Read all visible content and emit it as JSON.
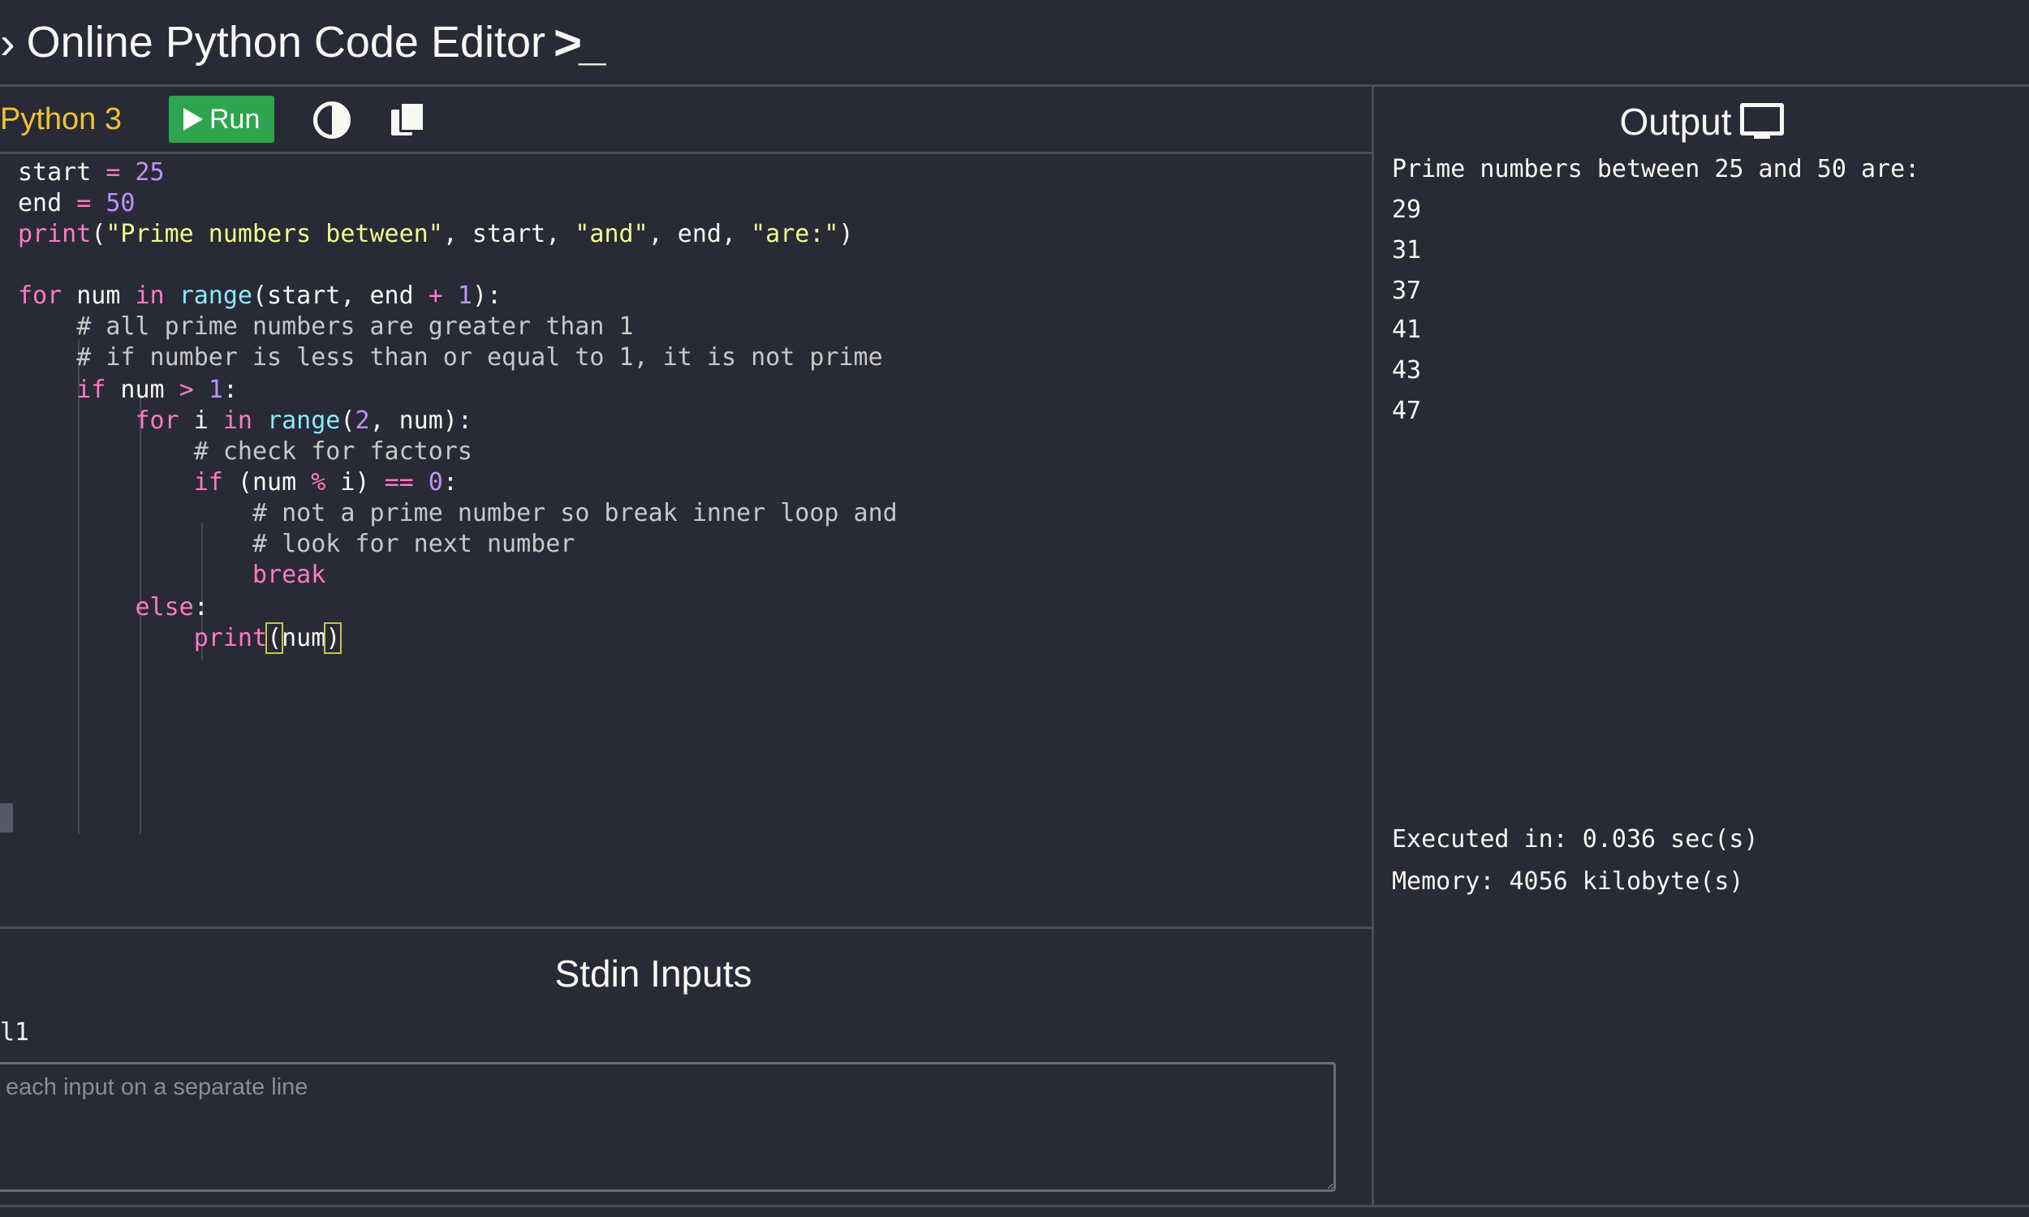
{
  "header": {
    "chevron": "›",
    "title": "Online Python Code Editor",
    "terminal": ">_"
  },
  "toolbar": {
    "language": "Python 3",
    "run_label": "Run",
    "icons": [
      "contrast-icon",
      "copy-icon"
    ]
  },
  "code_lines": [
    [
      [
        "start ",
        "t"
      ],
      [
        "=",
        "op"
      ],
      [
        " ",
        "t"
      ],
      [
        "25",
        "num"
      ]
    ],
    [
      [
        "end ",
        "t"
      ],
      [
        "=",
        "op"
      ],
      [
        " ",
        "t"
      ],
      [
        "50",
        "num"
      ]
    ],
    [
      [
        "print",
        "fn"
      ],
      [
        "(",
        "t"
      ],
      [
        "\"Prime numbers between\"",
        "str"
      ],
      [
        ", start, ",
        "t"
      ],
      [
        "\"and\"",
        "str"
      ],
      [
        ", end, ",
        "t"
      ],
      [
        "\"are:\"",
        "str"
      ],
      [
        ")",
        "t"
      ]
    ],
    [],
    [
      [
        "for",
        "kw"
      ],
      [
        " num ",
        "t"
      ],
      [
        "in",
        "kw"
      ],
      [
        " ",
        "t"
      ],
      [
        "range",
        "bi"
      ],
      [
        "(start, end ",
        "t"
      ],
      [
        "+",
        "op"
      ],
      [
        " ",
        "t"
      ],
      [
        "1",
        "num"
      ],
      [
        "):",
        "t"
      ]
    ],
    [
      [
        "    # all prime numbers are greater than 1",
        "cm"
      ]
    ],
    [
      [
        "    # if number is less than or equal to 1, it is not prime",
        "cm"
      ]
    ],
    [
      [
        "    ",
        "t"
      ],
      [
        "if",
        "kw"
      ],
      [
        " num ",
        "t"
      ],
      [
        ">",
        "op"
      ],
      [
        " ",
        "t"
      ],
      [
        "1",
        "num"
      ],
      [
        ":",
        "t"
      ]
    ],
    [
      [
        "        ",
        "t"
      ],
      [
        "for",
        "kw"
      ],
      [
        " i ",
        "t"
      ],
      [
        "in",
        "kw"
      ],
      [
        " ",
        "t"
      ],
      [
        "range",
        "bi"
      ],
      [
        "(",
        "t"
      ],
      [
        "2",
        "num"
      ],
      [
        ", num):",
        "t"
      ]
    ],
    [
      [
        "            # check for factors",
        "cm"
      ]
    ],
    [
      [
        "            ",
        "t"
      ],
      [
        "if",
        "kw"
      ],
      [
        " (num ",
        "t"
      ],
      [
        "%",
        "op"
      ],
      [
        " i) ",
        "t"
      ],
      [
        "==",
        "op"
      ],
      [
        " ",
        "t"
      ],
      [
        "0",
        "num"
      ],
      [
        ":",
        "t"
      ]
    ],
    [
      [
        "                # not a prime number so break inner loop and",
        "cm"
      ]
    ],
    [
      [
        "                # look for next number",
        "cm"
      ]
    ],
    [
      [
        "                ",
        "t"
      ],
      [
        "break",
        "kw"
      ]
    ],
    [
      [
        "        ",
        "t"
      ],
      [
        "else",
        "kw"
      ],
      [
        ":",
        "t"
      ]
    ],
    [
      [
        "            ",
        "t"
      ],
      [
        "print",
        "fn"
      ],
      [
        "(",
        "match"
      ],
      [
        "num",
        "t"
      ],
      [
        ")",
        "match"
      ]
    ]
  ],
  "stdin": {
    "title": "Stdin Inputs",
    "value_label": "l1",
    "placeholder": "each input on a separate line"
  },
  "output": {
    "title": "Output",
    "lines": [
      "Prime numbers between 25 and 50 are:",
      "29",
      "31",
      "37",
      "41",
      "43",
      "47"
    ],
    "executed": "Executed in: 0.036 sec(s)",
    "memory": "Memory: 4056 kilobyte(s)"
  }
}
